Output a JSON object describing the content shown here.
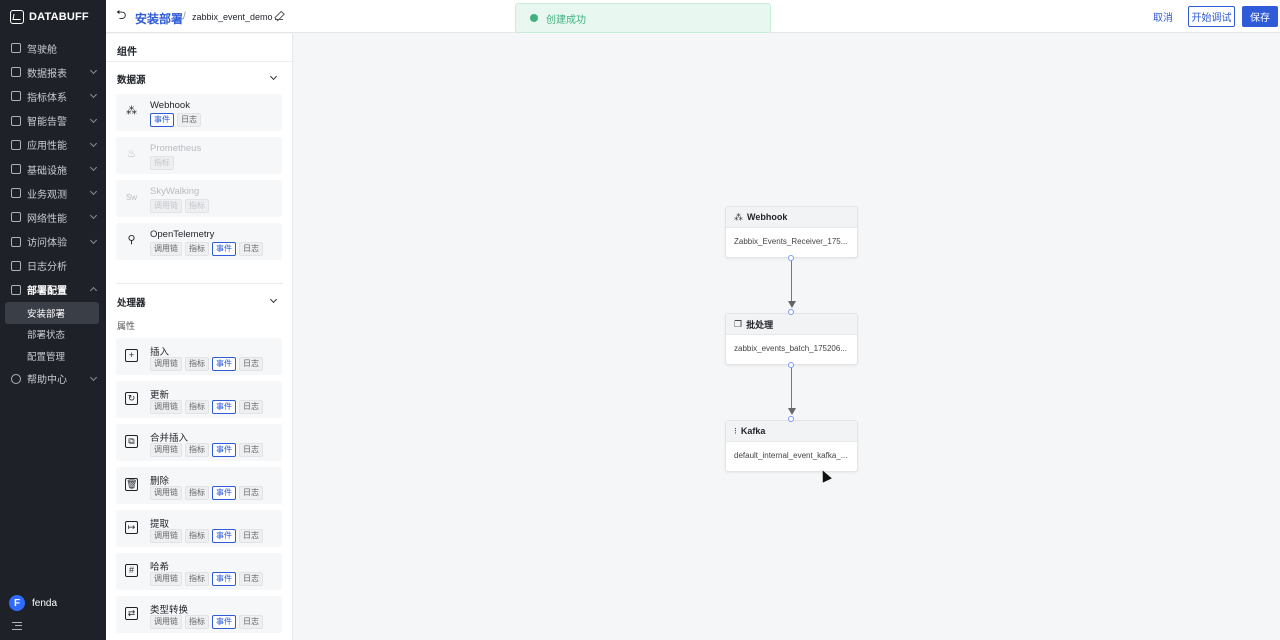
{
  "app": {
    "logo_text": "DATABUFF"
  },
  "nav": {
    "items": [
      {
        "label": "驾驶舱",
        "icon": "dashboard-icon",
        "has_children": false
      },
      {
        "label": "数据报表",
        "icon": "report-icon",
        "has_children": true
      },
      {
        "label": "指标体系",
        "icon": "metrics-icon",
        "has_children": true
      },
      {
        "label": "智能告警",
        "icon": "alert-icon",
        "has_children": true
      },
      {
        "label": "应用性能",
        "icon": "apm-icon",
        "has_children": true
      },
      {
        "label": "基础设施",
        "icon": "infra-icon",
        "has_children": true
      },
      {
        "label": "业务观测",
        "icon": "business-icon",
        "has_children": true
      },
      {
        "label": "网络性能",
        "icon": "network-icon",
        "has_children": true
      },
      {
        "label": "访问体验",
        "icon": "experience-icon",
        "has_children": true
      },
      {
        "label": "日志分析",
        "icon": "log-icon",
        "has_children": false
      },
      {
        "label": "部署配置",
        "icon": "deploy-icon",
        "has_children": true,
        "expanded": true
      }
    ],
    "deploy_children": [
      {
        "label": "安装部署",
        "selected": true
      },
      {
        "label": "部署状态",
        "selected": false
      },
      {
        "label": "配置管理",
        "selected": false
      }
    ],
    "help": {
      "label": "帮助中心",
      "icon": "help-icon"
    },
    "user": {
      "initial": "F",
      "name": "fenda"
    }
  },
  "header": {
    "breadcrumb_main": "安装部署",
    "breadcrumb_sep": "/",
    "breadcrumb_sub": "zabbix_event_demo",
    "toast": "创建成功",
    "cancel_label": "取消",
    "debug_label": "开始调试",
    "save_label": "保存"
  },
  "panel": {
    "title": "组件",
    "sources_title": "数据源",
    "processors_title": "处理器",
    "processors_sublabel": "属性",
    "sources": [
      {
        "name": "Webhook",
        "icon": "webhook-icon",
        "disabled": false,
        "tags": [
          {
            "label": "事件",
            "on": true
          },
          {
            "label": "日志",
            "on": false
          }
        ]
      },
      {
        "name": "Prometheus",
        "icon": "prometheus-icon",
        "disabled": true,
        "tags": [
          {
            "label": "指标",
            "on": false
          }
        ]
      },
      {
        "name": "SkyWalking",
        "icon": "skywalking-icon",
        "disabled": true,
        "tags": [
          {
            "label": "调用链",
            "on": false
          },
          {
            "label": "指标",
            "on": false
          }
        ]
      },
      {
        "name": "OpenTelemetry",
        "icon": "opentelemetry-icon",
        "disabled": false,
        "tags": [
          {
            "label": "调用链",
            "on": false
          },
          {
            "label": "指标",
            "on": false
          },
          {
            "label": "事件",
            "on": true
          },
          {
            "label": "日志",
            "on": false
          }
        ]
      }
    ],
    "processors": [
      {
        "name": "插入",
        "icon": "insert-icon",
        "glyph": "+"
      },
      {
        "name": "更新",
        "icon": "update-icon",
        "glyph": "↻"
      },
      {
        "name": "合并插入",
        "icon": "merge-insert-icon",
        "glyph": "⧉"
      },
      {
        "name": "删除",
        "icon": "delete-icon",
        "glyph": "🗑"
      },
      {
        "name": "提取",
        "icon": "extract-icon",
        "glyph": "↦"
      },
      {
        "name": "哈希",
        "icon": "hash-icon",
        "glyph": "#"
      },
      {
        "name": "类型转换",
        "icon": "type-convert-icon",
        "glyph": "⇄"
      }
    ],
    "processor_tags": [
      {
        "label": "调用链",
        "on": false
      },
      {
        "label": "指标",
        "on": false
      },
      {
        "label": "事件",
        "on": true
      },
      {
        "label": "日志",
        "on": false
      }
    ]
  },
  "canvas": {
    "nodes": [
      {
        "title": "Webhook",
        "icon": "webhook-icon",
        "body": "Zabbix_Events_Receiver_175..."
      },
      {
        "title": "批处理",
        "icon": "batch-icon",
        "body": "zabbix_events_batch_175206..."
      },
      {
        "title": "Kafka",
        "icon": "kafka-icon",
        "body": "default_internal_event_kafka_..."
      }
    ]
  }
}
